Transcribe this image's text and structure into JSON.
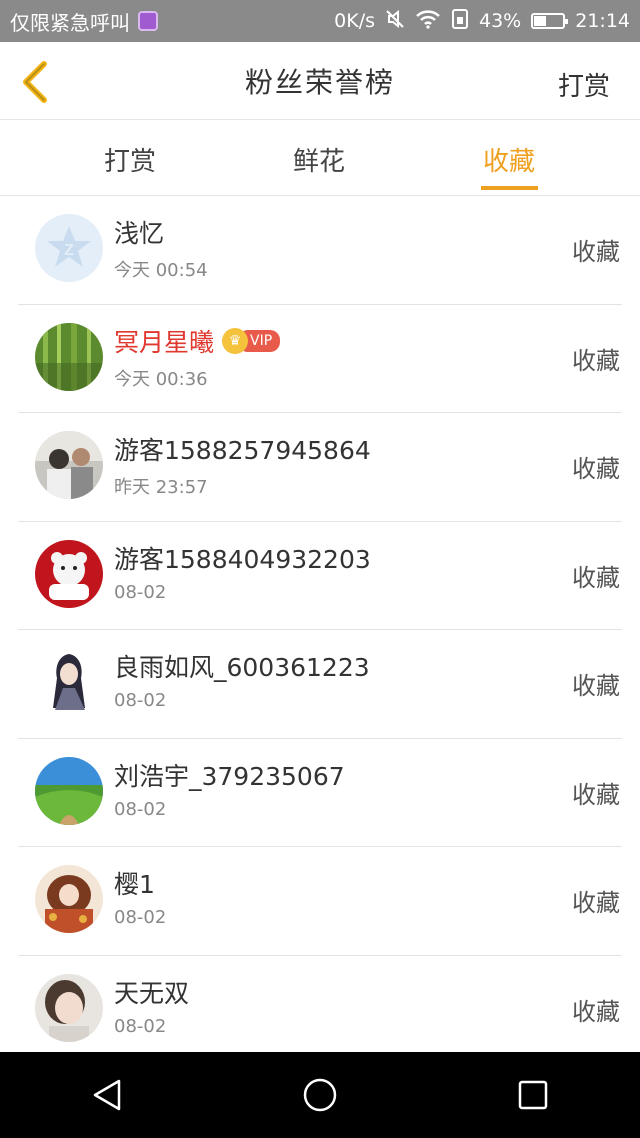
{
  "status_bar": {
    "carrier": "仅限紧急呼叫",
    "speed": "0K/s",
    "battery_text": "43%",
    "battery_level": 0.43,
    "time": "21:14"
  },
  "nav": {
    "title": "粉丝荣誉榜",
    "right_action": "打赏"
  },
  "tabs": [
    {
      "label": "打赏",
      "active": false
    },
    {
      "label": "鲜花",
      "active": false
    },
    {
      "label": "收藏",
      "active": true
    }
  ],
  "list": [
    {
      "name": "浅忆",
      "time": "今天 00:54",
      "action": "收藏",
      "vip": false
    },
    {
      "name": "冥月星曦",
      "time": "今天 00:36",
      "action": "收藏",
      "vip": true,
      "vip_label": "VIP"
    },
    {
      "name": "游客1588257945864",
      "time": "昨天 23:57",
      "action": "收藏",
      "vip": false
    },
    {
      "name": "游客1588404932203",
      "time": "08-02",
      "action": "收藏",
      "vip": false
    },
    {
      "name": "良雨如风_600361223",
      "time": "08-02",
      "action": "收藏",
      "vip": false
    },
    {
      "name": "刘浩宇_379235067",
      "time": "08-02",
      "action": "收藏",
      "vip": false
    },
    {
      "name": "樱1",
      "time": "08-02",
      "action": "收藏",
      "vip": false
    },
    {
      "name": "天无双",
      "time": "08-02",
      "action": "收藏",
      "vip": false
    }
  ],
  "colors": {
    "accent": "#f0a020",
    "vip_name": "#e0372e",
    "status_bar": "#8a8a8a"
  }
}
